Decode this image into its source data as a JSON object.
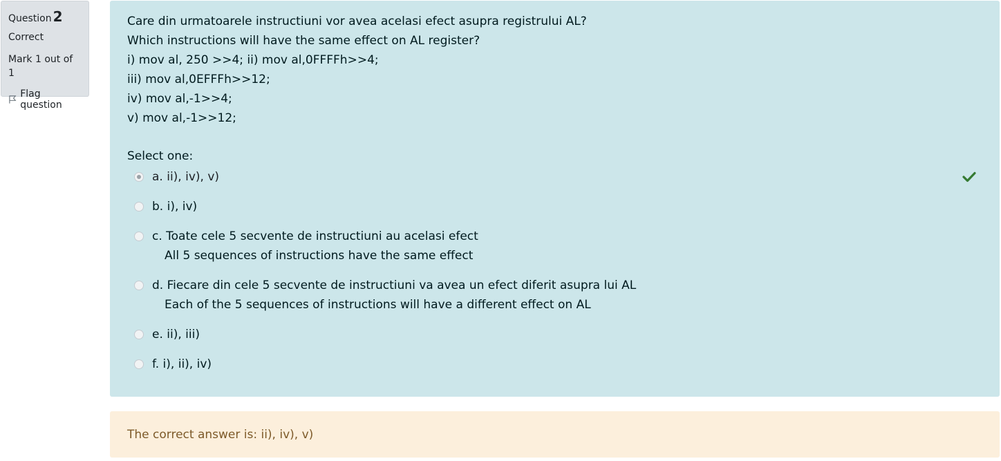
{
  "info": {
    "question_label": "Question",
    "question_number": "2",
    "state": "Correct",
    "grade": "Mark 1 out of 1",
    "flag_label": "Flag question"
  },
  "question": {
    "lines": [
      "Care din urmatoarele instructiuni vor avea acelasi efect asupra registrului AL?",
      "Which instructions will have the same effect on AL register?",
      "i) mov al, 250 >>4; ii) mov al,0FFFFh>>4;",
      "iii) mov al,0EFFFh>>12;",
      "iv) mov al,-1>>4;",
      "v) mov al,-1>>12;"
    ],
    "prompt": "Select one:",
    "options": [
      {
        "text": "a. ii), iv), v)",
        "sub": "",
        "selected": true
      },
      {
        "text": "b. i), iv)",
        "sub": "",
        "selected": false
      },
      {
        "text": "c. Toate cele 5 secvente de instructiuni au acelasi efect",
        "sub": "All 5 sequences of instructions have the same effect",
        "selected": false
      },
      {
        "text": "d. Fiecare din cele 5 secvente de instructiuni va avea un efect diferit asupra lui AL",
        "sub": "Each of the 5 sequences of instructions will have a different effect on AL",
        "selected": false
      },
      {
        "text": "e. ii), iii)",
        "sub": "",
        "selected": false
      },
      {
        "text": "f. i), ii), iv)",
        "sub": "",
        "selected": false
      }
    ]
  },
  "feedback": {
    "right_answer": "The correct answer is: ii), iv), v)"
  },
  "colors": {
    "info_bg": "#dee2e6",
    "formulation_bg": "#cce6ea",
    "feedback_bg": "#fcefdc",
    "feedback_text": "#7d5a29",
    "correct_tick": "#357a32"
  }
}
